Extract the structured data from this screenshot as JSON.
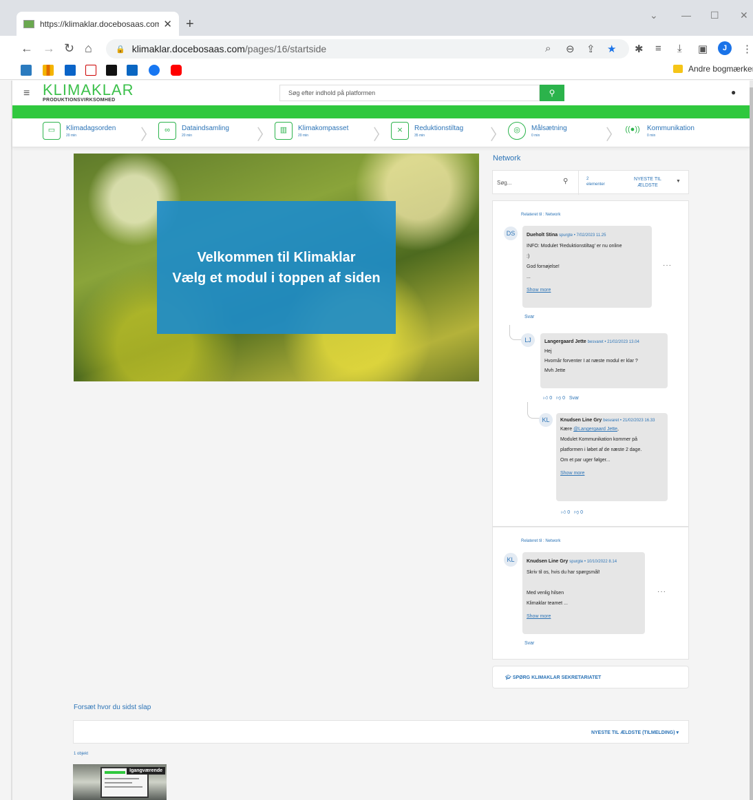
{
  "browser": {
    "tab_title": "https://klimaklar.docebosaas.com",
    "url_host": "klimaklar.docebosaas.com",
    "url_path": "/pages/16/startside",
    "other_bookmarks": "Andre bogmærker",
    "profile_initial": "J"
  },
  "site": {
    "logo_main": "KLIMAKLAR",
    "logo_sub": "PRODUKTIONSVIRKSOMHED",
    "search_placeholder": "Søg efter indhold på platformen",
    "brand_green": "#30c83e",
    "accent_blue": "#2b73b6"
  },
  "modules": [
    {
      "title": "Klimadagsorden",
      "duration": "20 min",
      "icon": "presentation-icon"
    },
    {
      "title": "Dataindsamling",
      "duration": "20 min",
      "icon": "binoculars-icon"
    },
    {
      "title": "Klimakompasset",
      "duration": "20 min",
      "icon": "bar-chart-icon"
    },
    {
      "title": "Reduktionstiltag",
      "duration": "35 min",
      "icon": "strategy-board-icon"
    },
    {
      "title": "Målsætning",
      "duration": "0 min",
      "icon": "target-icon"
    },
    {
      "title": "Kommunikation",
      "duration": "0 min",
      "icon": "microphone-icon"
    }
  ],
  "hero": {
    "line1": "Velkommen til Klimaklar",
    "line2": "Vælg et modul i toppen af siden"
  },
  "network": {
    "title": "Network",
    "search_placeholder": "Søg...",
    "count_num": "2",
    "count_label": "elementer",
    "sort_label": "NYESTE TIL ÆLDSTE",
    "posts": [
      {
        "related": "Relateret til : Network",
        "initials": "DS",
        "author": "Dueholt Stina",
        "meta": "spurgte • 7/02/2023 11.25",
        "lines": [
          "INFO: Modulet 'Reduktionstiltag' er nu online",
          ":)",
          "God fornøjelse!",
          "..."
        ],
        "show_more": "Show more",
        "reply": "Svar",
        "answers": [
          {
            "initials": "LJ",
            "author": "Langergaard Jette",
            "meta": "besvaret • 21/02/2023 13.04",
            "lines": [
              "Hej",
              "Hvornår forventer I at næste modul er klar ?",
              "Mvh Jette"
            ],
            "likes": "0",
            "dislikes": "0",
            "reply": "Svar"
          },
          {
            "initials": "KL",
            "author": "Knudsen Line Gry",
            "meta": "besvaret • 21/02/2023 16.33",
            "mention_prefix": "Kære ",
            "mention": "@Langergaard Jette",
            "mention_suffix": ",",
            "lines": [
              "Modulet Kommunikation kommer på",
              "platformen i løbet af de næste 2 dage.",
              "Om et par uger følger..."
            ],
            "show_more": "Show more",
            "likes": "0",
            "dislikes": "0"
          }
        ]
      },
      {
        "related": "Relateret til : Network",
        "initials": "KL",
        "author": "Knudsen Line Gry",
        "meta": "spurgte • 10/10/2022 8.14",
        "lines": [
          "Skriv til os, hvis du har spørgsmål!",
          "",
          "Med venlig hilsen",
          "Klimaklar teamet ..."
        ],
        "show_more": "Show more",
        "reply": "Svar"
      }
    ],
    "ask_button": "SPØRG KLIMAKLAR SEKRETARIATET"
  },
  "continue": {
    "title": "Forsæt hvor du sidst slap",
    "sort_label": "NYESTE TIL ÆLDSTE (TILMELDING)",
    "object_count": "1 objekt",
    "badge": "Igangværende"
  }
}
